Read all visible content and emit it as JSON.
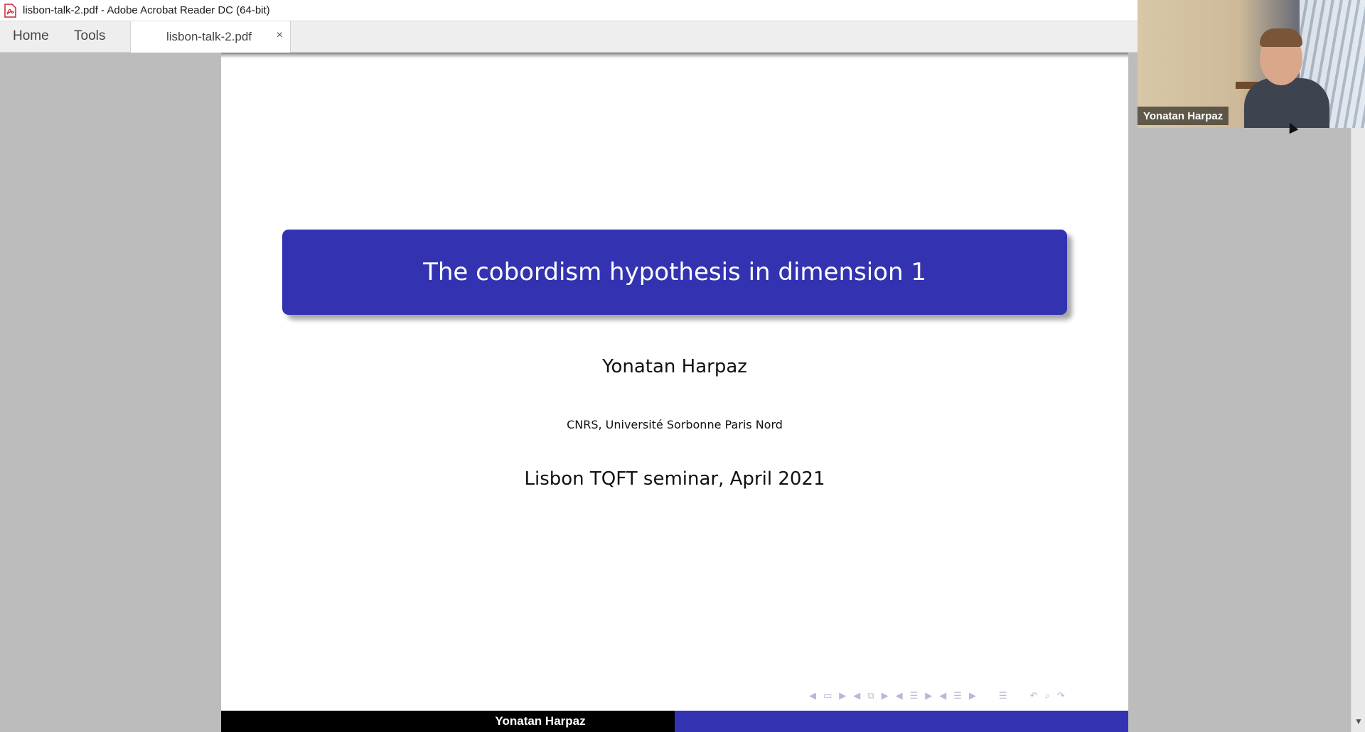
{
  "window": {
    "title": "lisbon-talk-2.pdf - Adobe Acrobat Reader DC (64-bit)"
  },
  "tabbar": {
    "home_label": "Home",
    "tools_label": "Tools",
    "doc_tab_label": "lisbon-talk-2.pdf",
    "close_symbol": "×"
  },
  "slide": {
    "title": "The cobordism hypothesis in dimension 1",
    "author": "Yonatan Harpaz",
    "institute": "CNRS, Université Sorbonne Paris Nord",
    "event": "Lisbon TQFT seminar, April 2021",
    "footer_author": "Yonatan Harpaz"
  },
  "webcam": {
    "participant_name": "Yonatan Harpaz"
  },
  "colors": {
    "beamer_blue": "#3333b2",
    "viewer_gray": "#bcbcbc",
    "footer_black": "#000000"
  },
  "icons": {
    "app": "acrobat-pdf-icon",
    "nav": [
      "triangle-left-icon",
      "frame-icon",
      "triangle-right-icon",
      "triangle-left-icon",
      "subsection-icon",
      "triangle-right-icon",
      "triangle-left-icon",
      "section-icon",
      "triangle-right-icon",
      "triangle-left-icon",
      "section-icon",
      "triangle-right-icon",
      "appendix-icon",
      "back-icon",
      "search-icon",
      "forward-icon"
    ]
  }
}
